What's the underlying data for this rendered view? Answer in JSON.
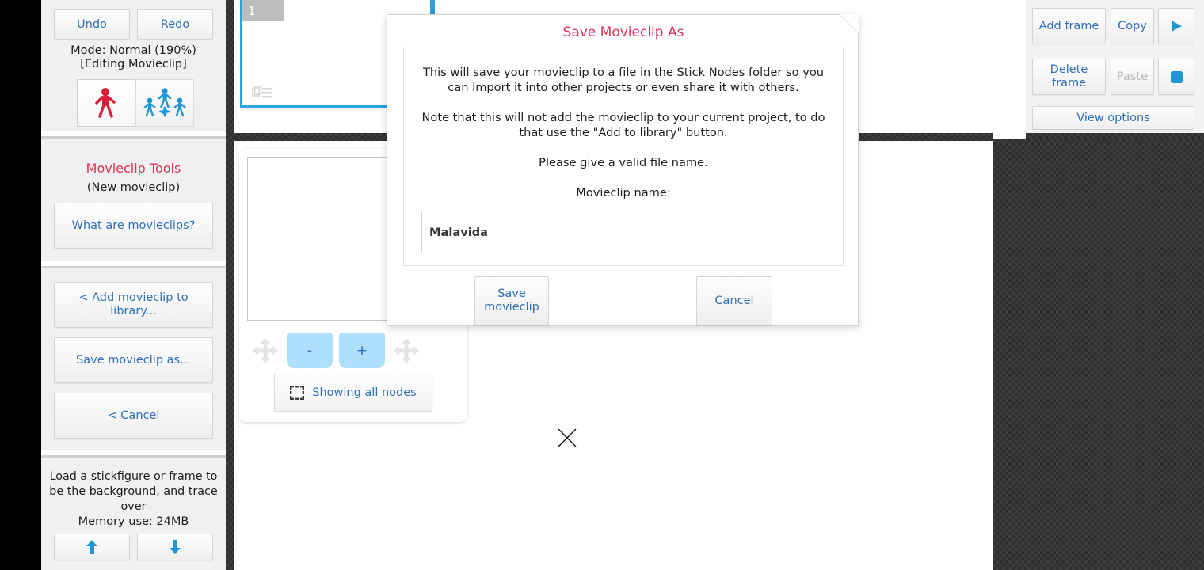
{
  "sidebar": {
    "undo_label": "Undo",
    "redo_label": "Redo",
    "mode_line1": "Mode: Normal (190%)",
    "mode_line2": "[Editing Movieclip]",
    "mode_toggle": {
      "single_figure_icon": "single-stickfigure-icon",
      "multi_figure_icon": "multi-stickfigure-icon"
    },
    "tools_title": "Movieclip Tools",
    "tools_subtitle": "(New movieclip)",
    "what_are_movieclips_label": "What are movieclips?",
    "add_to_library_label": "< Add movieclip to library...",
    "save_movieclip_as_label": "Save movieclip as...",
    "cancel_label": "< Cancel",
    "trace_note": "Load a stickfigure or frame to be the background, and trace over",
    "memory_label": "Memory use: 24MB",
    "up_arrow_icon": "arrow-up-icon",
    "down_arrow_icon": "arrow-down-icon"
  },
  "timeline": {
    "frame_number": "1",
    "frame_layers_icon": "layers-icon"
  },
  "canvas": {
    "zoom_out_label": "-",
    "zoom_in_label": "+",
    "pan_left_icon": "move-arrows-icon",
    "pan_right_icon": "move-arrows-icon",
    "nodes_label": "Showing all nodes",
    "nodes_icon": "selection-box-icon",
    "close_mark_icon": "x-mark-icon"
  },
  "right_toolbar": {
    "add_frame_label": "Add frame",
    "copy_label": "Copy",
    "play_icon": "play-icon",
    "delete_frame_label": "Delete frame",
    "paste_label": "Paste",
    "paste_disabled": true,
    "stop_icon": "stop-square-icon",
    "view_options_label": "View options"
  },
  "dialog": {
    "title": "Save Movieclip As",
    "paragraph1": "This will save your movieclip to a file in the Stick Nodes folder so you can import it into other projects or even share it with others.",
    "paragraph2": "Note that this will not add the movieclip to your current project, to do that use the \"Add to library\" button.",
    "paragraph3": "Please give a valid file name.",
    "field_label": "Movieclip name:",
    "name_value": "Malavida",
    "name_placeholder": "",
    "save_label": "Save movieclip",
    "cancel_label": "Cancel"
  },
  "colors": {
    "accent_red": "#e0315b",
    "link_blue": "#2f6fb5",
    "highlight_blue": "#2aa3e0",
    "zoom_button_blue": "#ade0fb",
    "disabled_gray": "#b8b8b8"
  }
}
